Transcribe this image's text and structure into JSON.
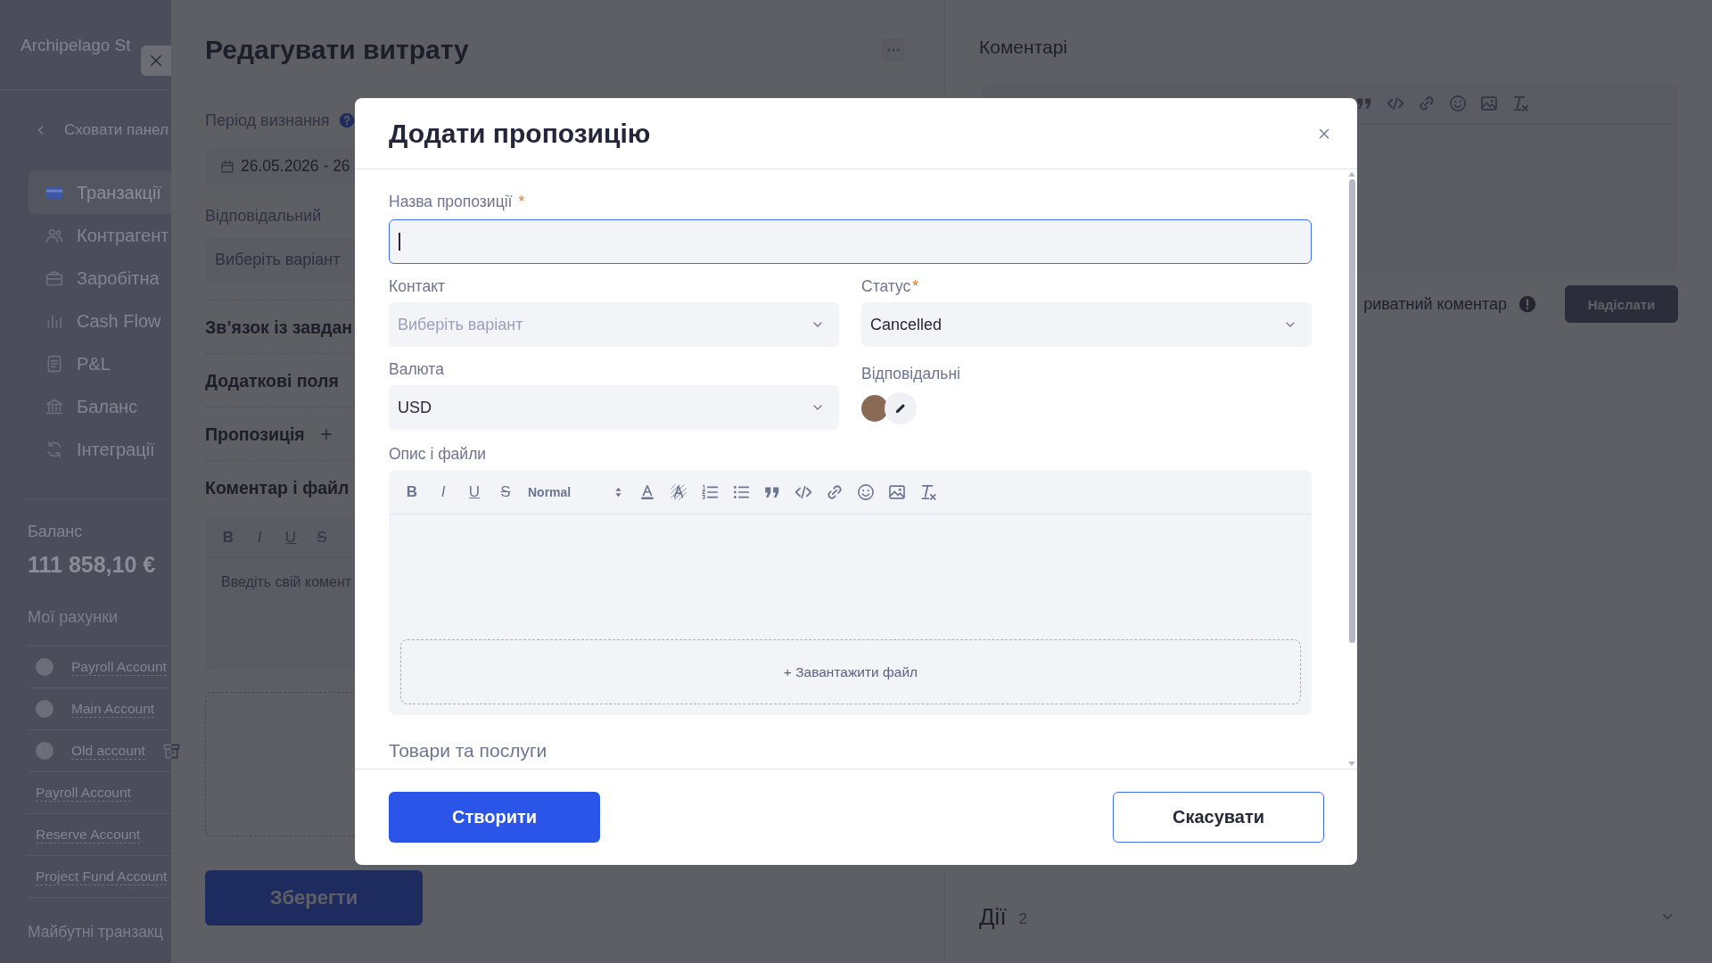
{
  "sidebar": {
    "brand": "Archipelago St",
    "collapse_label": "Сховати панел",
    "nav": [
      {
        "label": "Транзакції",
        "selected": true
      },
      {
        "label": "Контрагент",
        "selected": false
      },
      {
        "label": "Заробітна",
        "selected": false
      },
      {
        "label": "Cash Flow",
        "selected": false
      },
      {
        "label": "P&L",
        "selected": false
      },
      {
        "label": "Баланс",
        "selected": false
      },
      {
        "label": "Інтеграції",
        "selected": false
      }
    ],
    "balance": {
      "label": "Баланс",
      "amount": "111 858,10 €"
    },
    "accounts_heading": "Мої рахунки",
    "accounts": [
      {
        "name": "Payroll Account",
        "avatar": true,
        "archived": false
      },
      {
        "name": "Main Account",
        "avatar": true,
        "archived": false
      },
      {
        "name": "Old account",
        "avatar": true,
        "archived": true
      },
      {
        "name": "Payroll Account",
        "avatar": false,
        "archived": false
      },
      {
        "name": "Reserve Account",
        "avatar": false,
        "archived": false
      },
      {
        "name": "Project Fund Account",
        "avatar": false,
        "archived": false
      }
    ],
    "upcoming_heading": "Майбутні транзакц"
  },
  "drawer": {
    "title": "Редагувати витрату",
    "period": {
      "label": "Період визнання",
      "value": "26.05.2026 - 26"
    },
    "responsible": {
      "label": "Відповідальний",
      "placeholder": "Виберіть варіант"
    },
    "sections": [
      {
        "title": "Зв’язок із завдан",
        "addable": false
      },
      {
        "title": "Додаткові поля",
        "addable": false
      },
      {
        "title": "Пропозиція",
        "addable": true
      }
    ],
    "comment": {
      "title": "Коментар і файл",
      "toolbar": [
        {
          "kind": "bold",
          "label": "B"
        },
        {
          "kind": "italic",
          "label": "I"
        },
        {
          "kind": "underline",
          "label": "U"
        },
        {
          "kind": "strike",
          "label": "S"
        }
      ],
      "placeholder": "Введіть свій комент"
    },
    "save_button": "Зберегти"
  },
  "comments": {
    "title": "Коментарі",
    "toolbar": [
      {
        "kind": "quote"
      },
      {
        "kind": "code"
      },
      {
        "kind": "link"
      },
      {
        "kind": "emoji"
      },
      {
        "kind": "image"
      },
      {
        "kind": "clean"
      }
    ],
    "private_label": "риватний коментар",
    "send_button": "Надіслати",
    "actions": {
      "title": "Дії",
      "count": "2"
    }
  },
  "modal": {
    "title": "Додати пропозицію",
    "name_field": {
      "label": "Назва пропозиції",
      "required_mark": "*",
      "focused": true
    },
    "contact": {
      "label": "Контакт",
      "placeholder": "Виберіть варіант"
    },
    "status": {
      "label": "Статус",
      "required_mark": "*",
      "value": "Cancelled"
    },
    "currency": {
      "label": "Валюта",
      "value": "USD"
    },
    "assignees": {
      "label": "Відповідальні"
    },
    "description": {
      "label": "Опис і файли",
      "toolbar": [
        {
          "kind": "bold",
          "label": "B"
        },
        {
          "kind": "italic",
          "label": "I"
        },
        {
          "kind": "underline",
          "label": "U"
        },
        {
          "kind": "strike",
          "label": "S"
        },
        {
          "kind": "header",
          "label": "Normal"
        },
        {
          "kind": "color"
        },
        {
          "kind": "background"
        },
        {
          "kind": "ordered-list"
        },
        {
          "kind": "bullet-list"
        },
        {
          "kind": "quote"
        },
        {
          "kind": "code"
        },
        {
          "kind": "link"
        },
        {
          "kind": "emoji"
        },
        {
          "kind": "image"
        },
        {
          "kind": "clean"
        }
      ],
      "upload_label": "+ Завантажити файл"
    },
    "products_heading": "Товари та послуги",
    "create_button": "Створити",
    "cancel_button": "Скасувати"
  }
}
